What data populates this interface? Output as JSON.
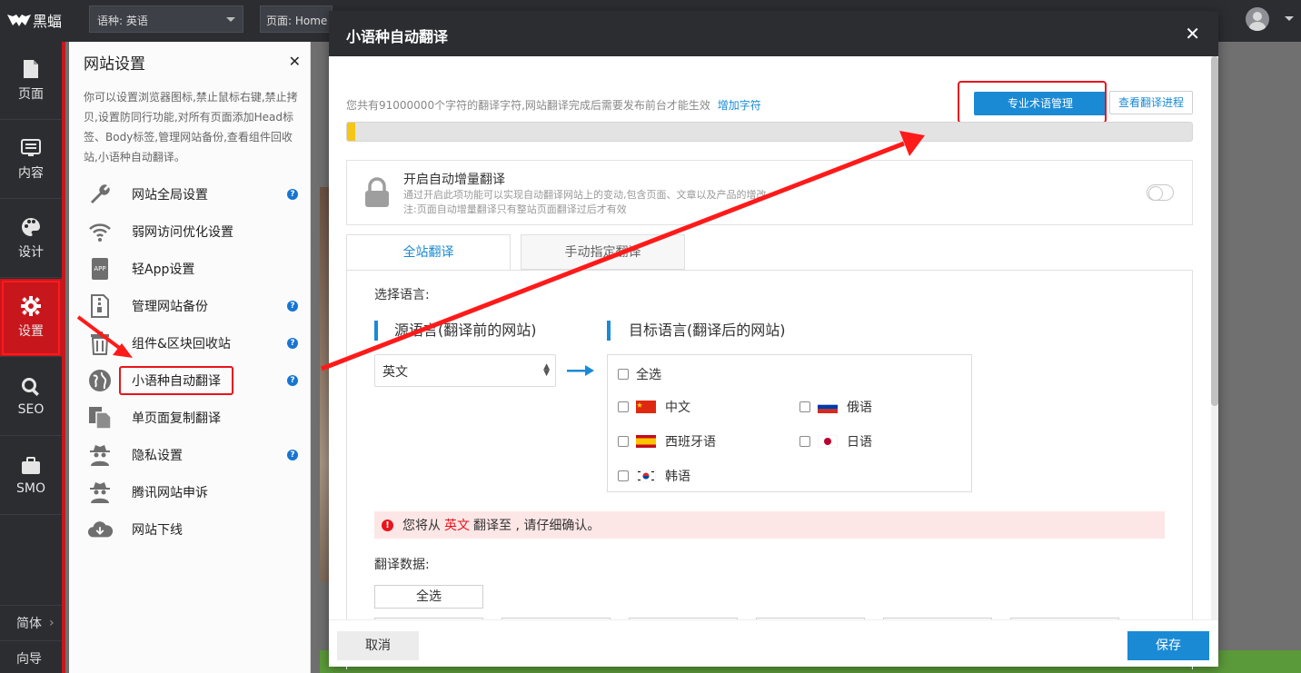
{
  "topbar": {
    "logo_text": "黑蝠",
    "lang_select": "语种: 英语",
    "page_select": "页面: Home"
  },
  "sidebar": {
    "items": [
      {
        "label": "页面",
        "icon": "file-icon"
      },
      {
        "label": "内容",
        "icon": "list-icon"
      },
      {
        "label": "设计",
        "icon": "palette-icon"
      },
      {
        "label": "设置",
        "icon": "gear-icon"
      },
      {
        "label": "SEO",
        "icon": "search-icon"
      },
      {
        "label": "SMO",
        "icon": "briefcase-icon"
      }
    ],
    "bottom": [
      "简体",
      "向导"
    ]
  },
  "panel": {
    "title": "网站设置",
    "description": "你可以设置浏览器图标,禁止鼠标右键,禁止拷贝,设置防同行功能,对所有页面添加Head标签、Body标签,管理网站备份,查看组件回收站,小语种自动翻译。",
    "items": [
      {
        "label": "网站全局设置",
        "icon": "wrench-icon",
        "help": true
      },
      {
        "label": "弱网访问优化设置",
        "icon": "wifi-icon",
        "help": false
      },
      {
        "label": "轻App设置",
        "icon": "app-icon",
        "help": false
      },
      {
        "label": "管理网站备份",
        "icon": "zip-file-icon",
        "help": true
      },
      {
        "label": "组件&区块回收站",
        "icon": "trash-icon",
        "help": true
      },
      {
        "label": "小语种自动翻译",
        "icon": "globe-icon",
        "help": true
      },
      {
        "label": "单页面复制翻译",
        "icon": "copy-icon",
        "help": false
      },
      {
        "label": "隐私设置",
        "icon": "spy-icon",
        "help": true
      },
      {
        "label": "腾讯网站申诉",
        "icon": "spy-icon",
        "help": false
      },
      {
        "label": "网站下线",
        "icon": "cloud-download-icon",
        "help": false
      }
    ]
  },
  "modal": {
    "title": "小语种自动翻译",
    "info_text": "您共有91000000个字符的翻译字符,网站翻译完成后需要发布前台才能生效",
    "add_chars_link": "增加字符",
    "terms_button": "专业术语管理",
    "progress_button": "查看翻译进程",
    "progress_fraction": 0.01,
    "auto_title": "开启自动增量翻译",
    "auto_desc_1": "通过开启此项功能可以实现自动翻译网站上的变动,包含页面、文章以及产品的增改",
    "auto_desc_2": "注:页面自动增量翻译只有整站页面翻译过后才有效",
    "tabs": [
      "全站翻译",
      "手动指定翻译"
    ],
    "select_lang_label": "选择语言:",
    "source_title": "源语言(翻译前的网站)",
    "target_title": "目标语言(翻译后的网站)",
    "source_value": "英文",
    "select_all": "全选",
    "targets": [
      {
        "label": "中文",
        "flag": "cn"
      },
      {
        "label": "俄语",
        "flag": "ru"
      },
      {
        "label": "西班牙语",
        "flag": "es"
      },
      {
        "label": "日语",
        "flag": "jp"
      },
      {
        "label": "韩语",
        "flag": "kr"
      }
    ],
    "warn_pre": "您将从",
    "warn_lang": "英文",
    "warn_post": "翻译至 , 请仔细确认。",
    "data_label": "翻译数据:",
    "data_select_all": "全选",
    "cancel": "取消",
    "save": "保存"
  },
  "colors": {
    "accent": "#1a8ad4",
    "brand_red": "#c8161d",
    "annotation_red": "#e8141c",
    "progress_fill": "#f5c518"
  }
}
